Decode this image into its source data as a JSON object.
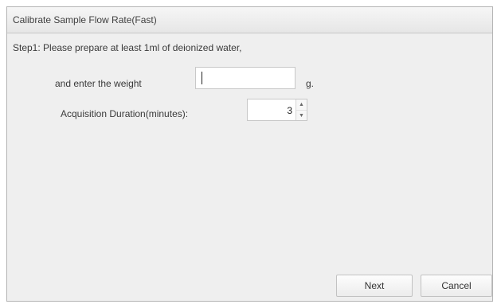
{
  "window": {
    "title": "Calibrate Sample Flow Rate(Fast)"
  },
  "step": {
    "instruction_line1": "Step1: Please prepare at least 1ml of deionized water,",
    "instruction_line2": "and enter the weight",
    "weight_value": "",
    "weight_unit": "g.",
    "duration_label": "Acquisition Duration(minutes):",
    "duration_value": "3"
  },
  "buttons": {
    "next_label": "Next",
    "cancel_label": "Cancel"
  },
  "icons": {
    "spin_up": "spin-up-arrow",
    "spin_down": "spin-down-arrow"
  }
}
